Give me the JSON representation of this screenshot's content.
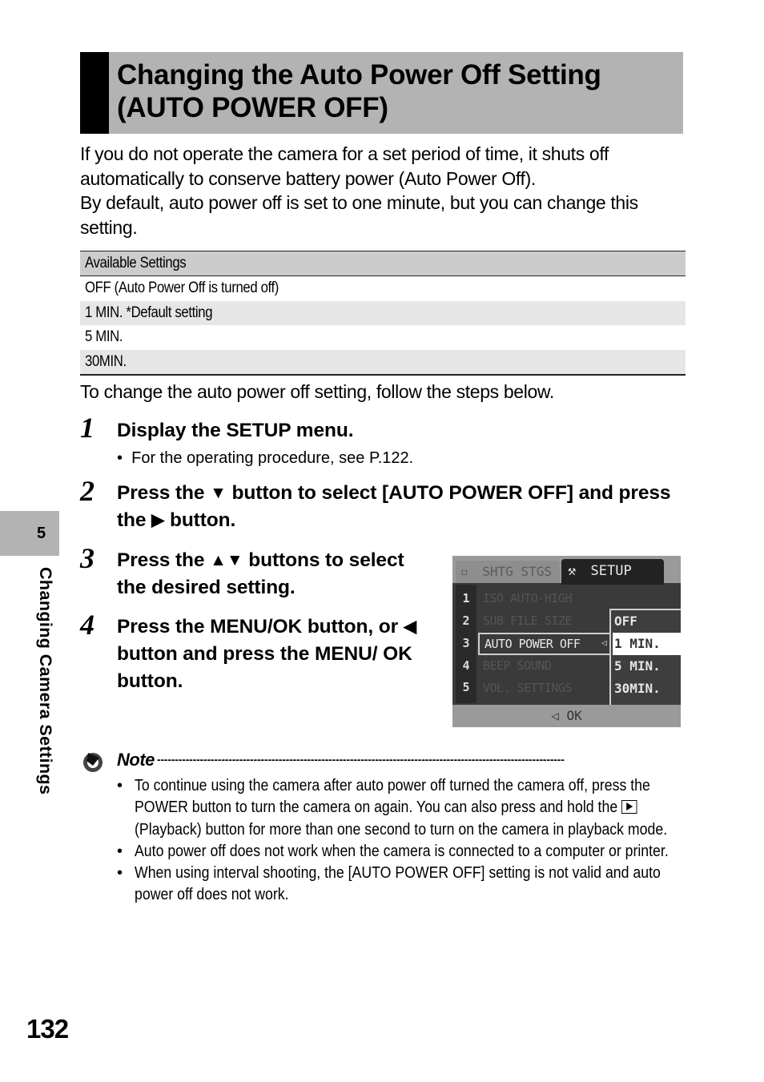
{
  "section": {
    "title_line1": "Changing the Auto Power Off Setting",
    "title_line2": "(AUTO POWER OFF)"
  },
  "intro": {
    "paragraph1": "If you do not operate the camera for a set period of time, it shuts off automatically to conserve battery power (Auto Power Off).",
    "paragraph2": "By default, auto power off is set to one minute, but you can change this setting."
  },
  "settings_table": {
    "header": "Available Settings",
    "rows": [
      "OFF (Auto Power Off is turned off)",
      "1 MIN. *Default setting",
      "5 MIN.",
      "30MIN."
    ]
  },
  "lead_text": "To change the auto power off setting, follow the steps below.",
  "steps": [
    {
      "number": "1",
      "text": "Display the SETUP menu.",
      "bullet": "For the operating procedure, see P.122."
    },
    {
      "number": "2",
      "text_a": "Press the",
      "icon_a": "▼",
      "text_b": "button to select [AUTO POWER OFF] and press the",
      "icon_b": "▶",
      "text_c": "button."
    },
    {
      "number": "3",
      "text_a": "Press the",
      "icon": "▲▼",
      "text_b": "buttons to select the desired setting."
    },
    {
      "number": "4",
      "text_a": "Press the MENU/OK button, or",
      "icon": "◀",
      "text_b": "button and press the MENU/ OK button."
    }
  ],
  "camera_screen": {
    "tab_inactive": "SHTG STGS",
    "tab_active": "SETUP",
    "menu_numbers": [
      "1",
      "2",
      "3",
      "4",
      "5"
    ],
    "menu_items": [
      "ISO AUTO-HIGH",
      "SUB FILE SIZE",
      "AUTO POWER OFF",
      "BEEP SOUND",
      "VOL. SETTINGS"
    ],
    "active_item_index": 2,
    "options": [
      "OFF",
      "1 MIN.",
      "5 MIN.",
      "30MIN."
    ],
    "selected_option": "1 MIN.",
    "bottom_hint": "◁ OK"
  },
  "note": {
    "label": "Note",
    "dashes": "------------------------------------------------------------------------------------------------------------------",
    "items": [
      {
        "text_a": "To continue using the camera after auto power off turned the camera off, press the POWER button to turn the camera on again. You can also press and hold the",
        "text_b": "(Playback) button for more than one second to turn on the camera in playback mode."
      },
      {
        "text": "Auto power off does not work when the camera is connected to a computer or printer."
      },
      {
        "text": "When using interval shooting, the [AUTO POWER OFF] setting is not valid and auto power off does not work."
      }
    ],
    "bullet": "•"
  },
  "side_tab": {
    "chapter_number": "5",
    "chapter_title": "Changing Camera Settings"
  },
  "page_number": "132"
}
